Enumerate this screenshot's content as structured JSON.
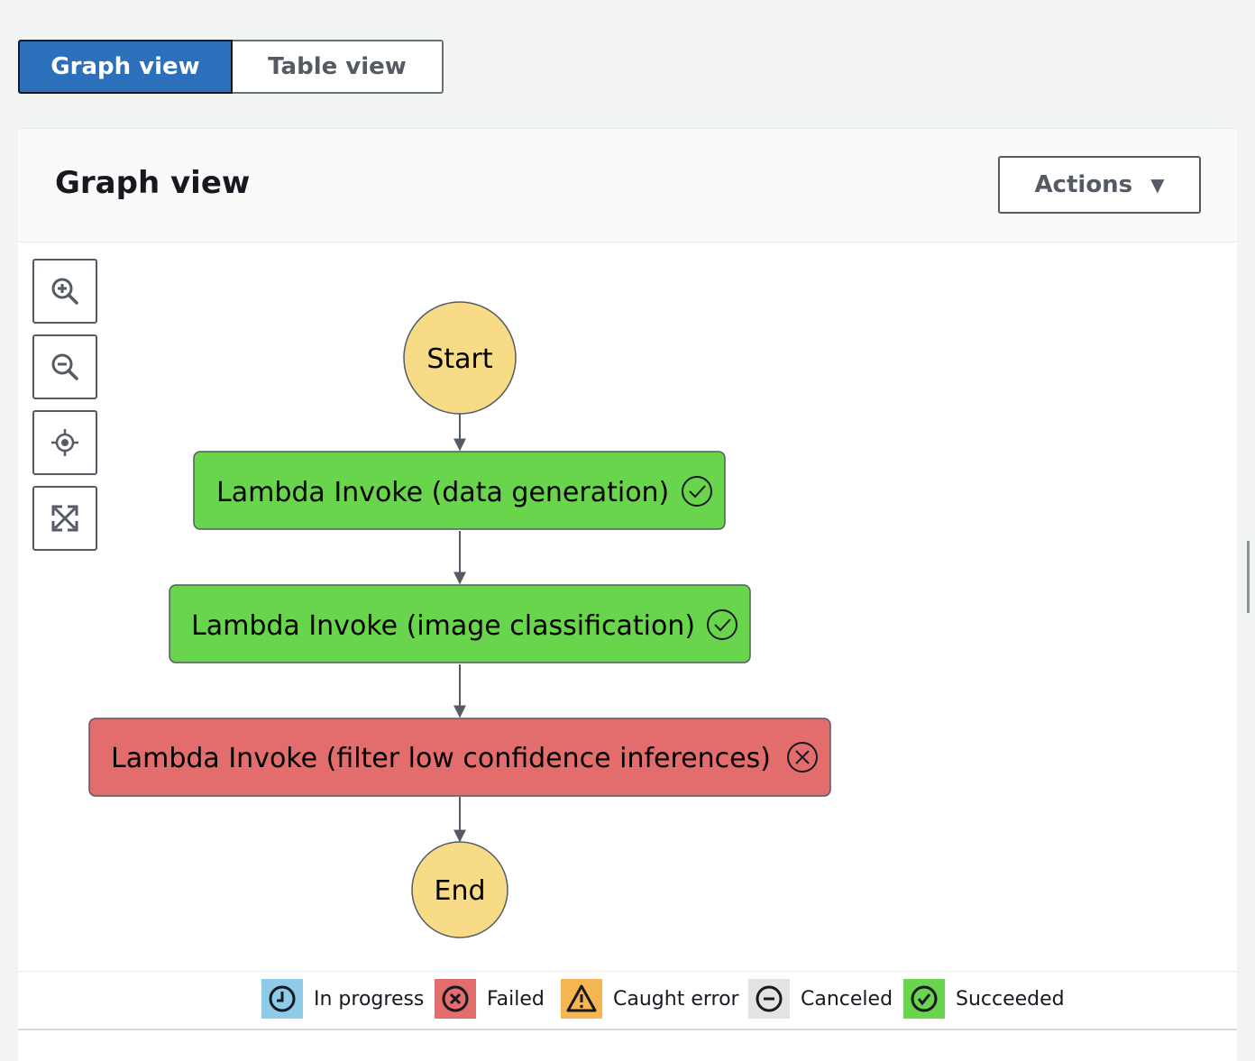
{
  "view_toggle": {
    "graph_label": "Graph view",
    "table_label": "Table view",
    "selected": "Graph view"
  },
  "panel": {
    "title": "Graph view",
    "actions_label": "Actions"
  },
  "toolbar": {
    "items": [
      {
        "icon": "zoom-in-icon"
      },
      {
        "icon": "zoom-out-icon"
      },
      {
        "icon": "center-icon"
      },
      {
        "icon": "fit-to-screen-icon"
      }
    ]
  },
  "graph": {
    "start_label": "Start",
    "end_label": "End",
    "states": [
      {
        "label": "Lambda Invoke (data generation)",
        "status": "Succeeded",
        "color": "#69d54c"
      },
      {
        "label": "Lambda Invoke (image classification)",
        "status": "Succeeded",
        "color": "#69d54c"
      },
      {
        "label": "Lambda Invoke (filter low confidence inferences)",
        "status": "Failed",
        "color": "#e36c6c"
      }
    ],
    "terminal_color": "#f8db86"
  },
  "legend": [
    {
      "label": "In progress",
      "color": "#8dcbe9",
      "icon": "clock-icon"
    },
    {
      "label": "Failed",
      "color": "#e36c6c",
      "icon": "x-circle-icon"
    },
    {
      "label": "Caught error",
      "color": "#f5b652",
      "icon": "warning-icon"
    },
    {
      "label": "Canceled",
      "color": "#e3e3e3",
      "icon": "minus-circle-icon"
    },
    {
      "label": "Succeeded",
      "color": "#69d54c",
      "icon": "check-circle-icon"
    }
  ]
}
